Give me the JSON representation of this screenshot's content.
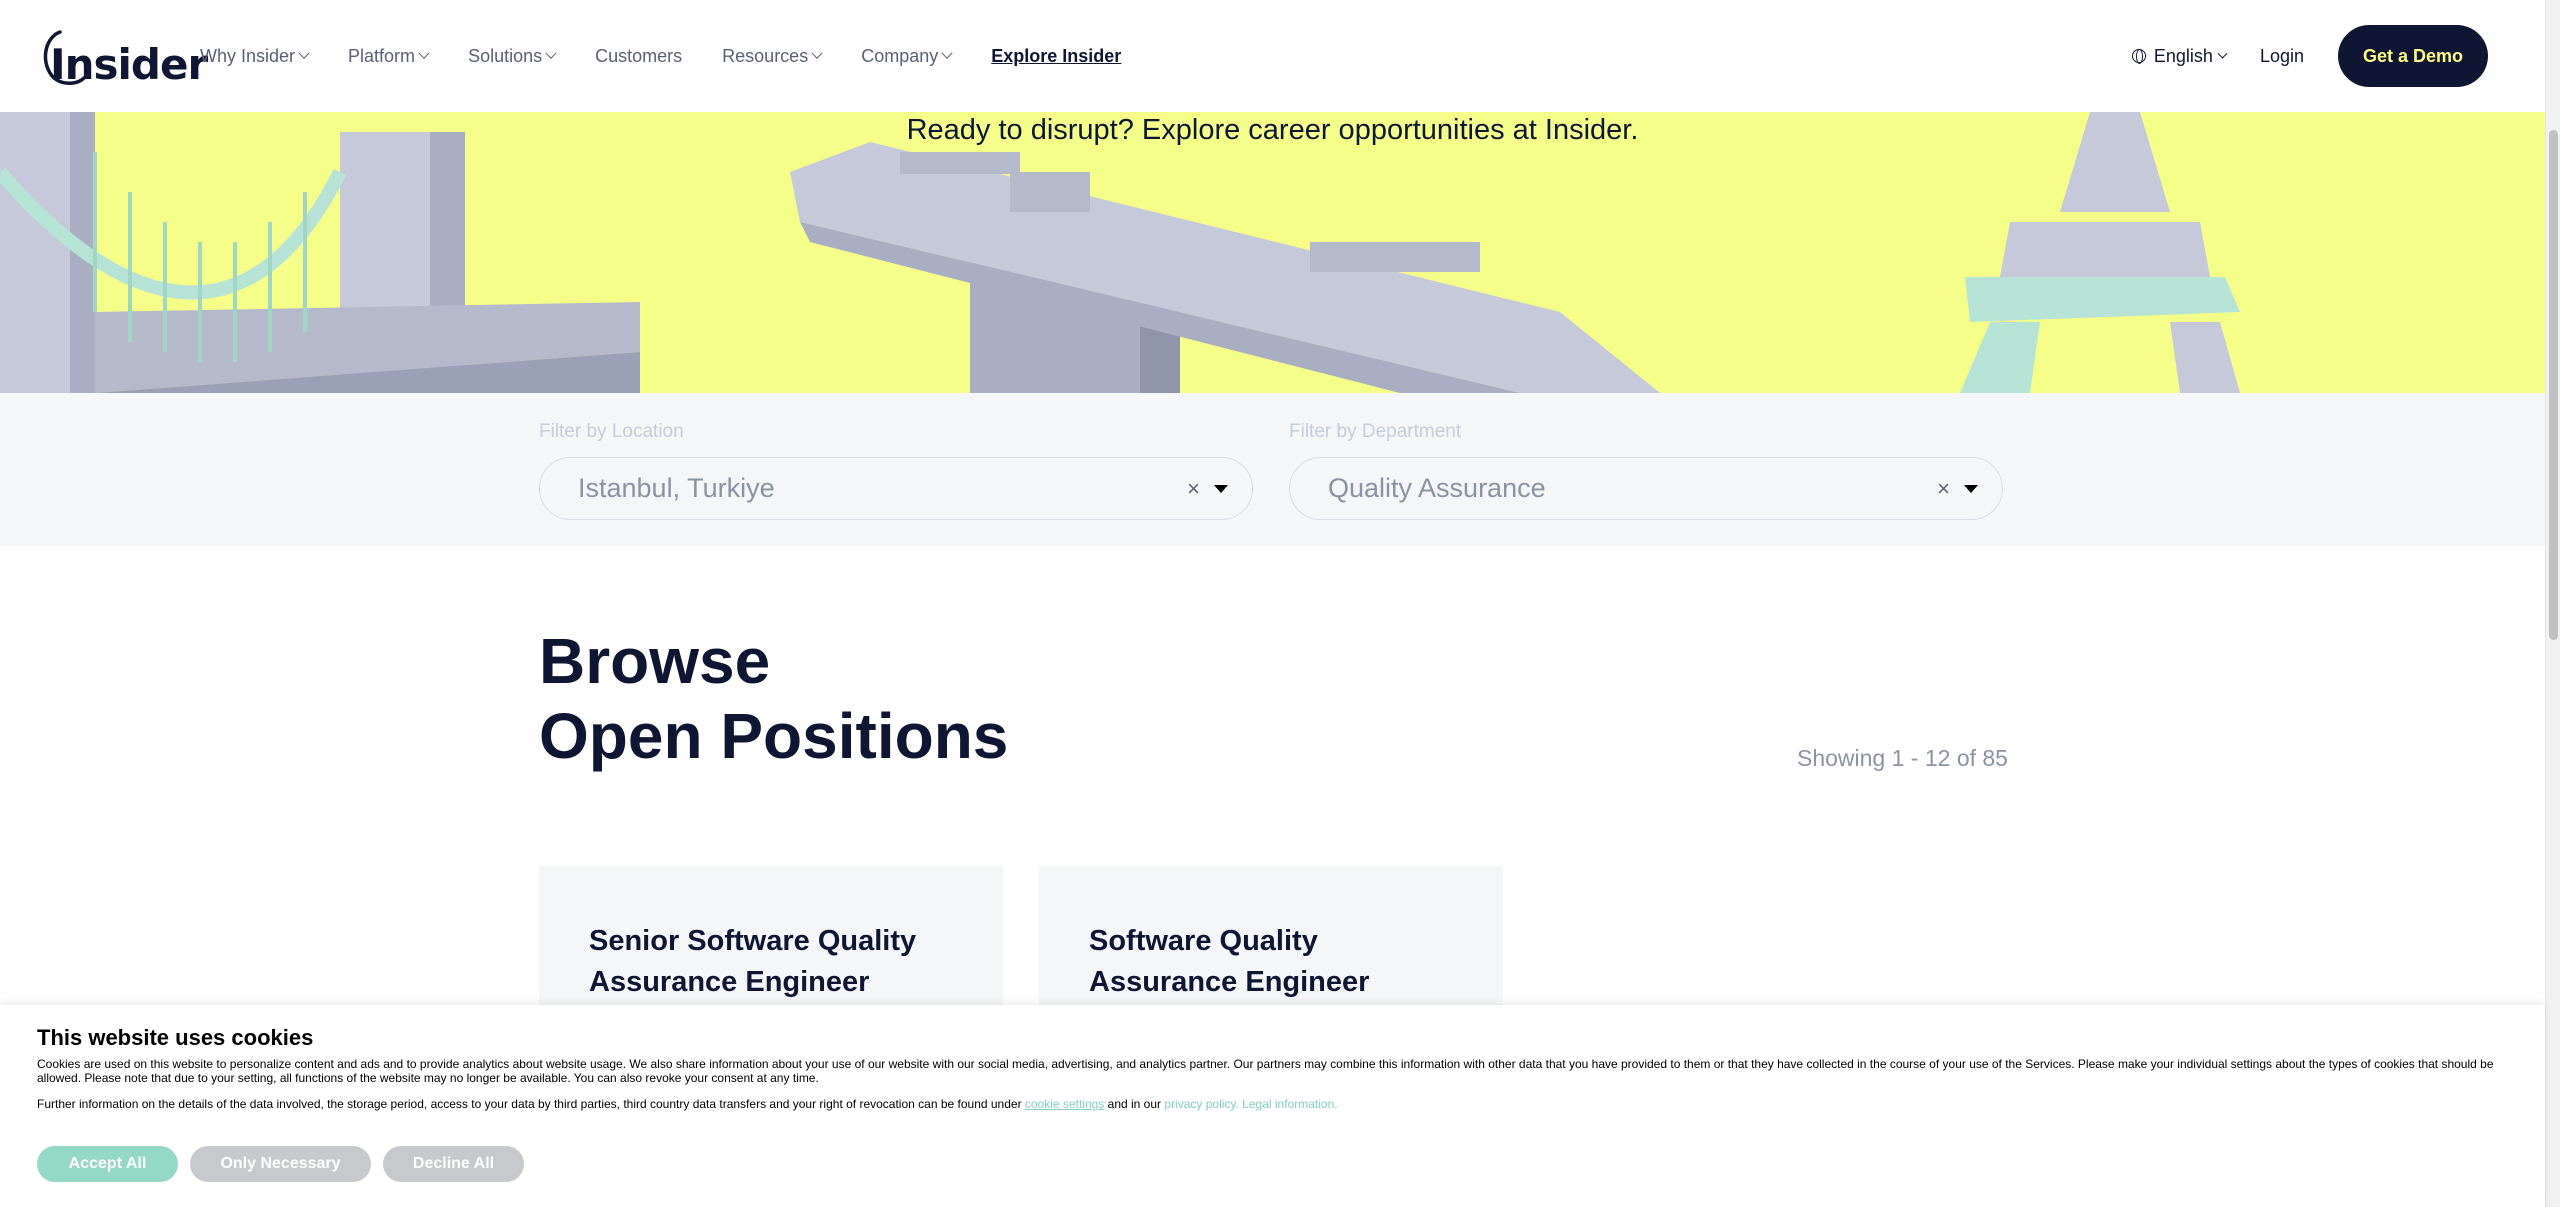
{
  "header": {
    "logo_text": "Insider",
    "nav": [
      {
        "label": "Why Insider",
        "dropdown": true
      },
      {
        "label": "Platform",
        "dropdown": true
      },
      {
        "label": "Solutions",
        "dropdown": true
      },
      {
        "label": "Customers",
        "dropdown": false
      },
      {
        "label": "Resources",
        "dropdown": true
      },
      {
        "label": "Company",
        "dropdown": true
      },
      {
        "label": "Explore Insider",
        "dropdown": false
      }
    ],
    "language": "English",
    "login": "Login",
    "demo": "Get a Demo"
  },
  "hero": {
    "title": "Ready to disrupt? Explore career opportunities at Insider."
  },
  "filters": {
    "location_label": "Filter by Location",
    "location_value": "Istanbul, Turkiye",
    "department_label": "Filter by Department",
    "department_value": "Quality Assurance",
    "clear_symbol": "×"
  },
  "browse": {
    "title_line1": "Browse",
    "title_line2": "Open Positions",
    "showing": "Showing 1 - 12 of 85"
  },
  "jobs": [
    {
      "title": "Senior Software Quality Assurance Engineer"
    },
    {
      "title": "Software Quality Assurance Engineer"
    }
  ],
  "cookie": {
    "title": "This website uses cookies",
    "text": "Cookies are used on this website to personalize content and ads and to provide analytics about website usage. We also share information about your use of our website with our social media, advertising, and analytics partner. Our partners may combine this information with other data that you have provided to them or that they have collected in the course of your use of the Services. Please make your individual settings about the types of cookies that should be allowed. Please note that due to your setting, all functions of the website may no longer be available. You can also revoke your consent at any time.",
    "more_prefix": "Further information on the details of the data involved, the storage period, access to your data by third parties, third country data transfers and your right of revocation can be found under",
    "cookie_settings": "cookie settings",
    "more_middle": "and in our",
    "privacy_policy": "privacy policy.",
    "legal": "Legal information.",
    "accept": "Accept All",
    "necessary": "Only Necessary",
    "decline": "Decline All"
  },
  "colors": {
    "brand_navy": "#0f1633",
    "hero_yellow": "#f6fe8a",
    "accent_mint": "#94d8c6",
    "demo_text": "#fffd80"
  }
}
